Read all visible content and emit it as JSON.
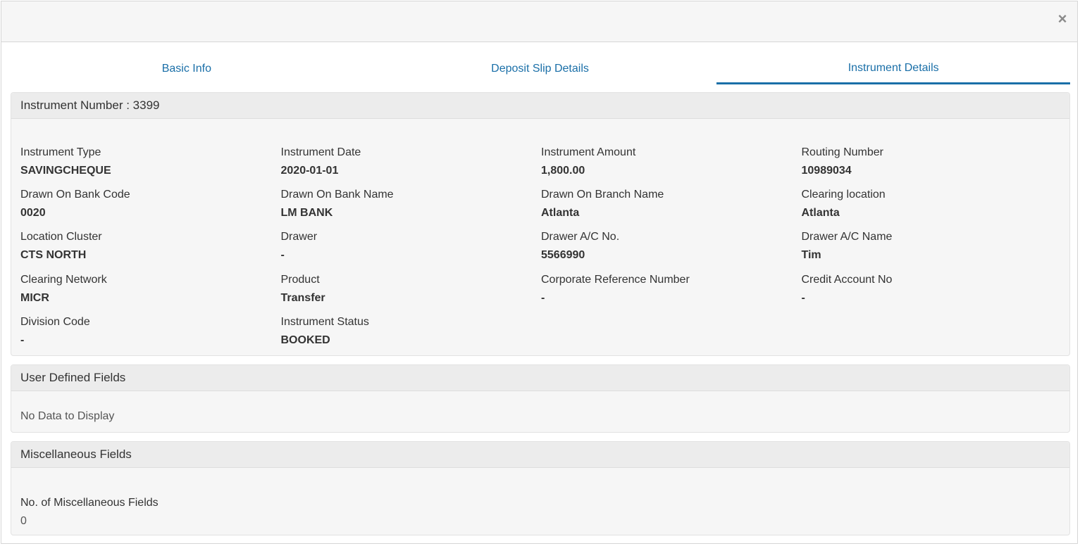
{
  "header": {
    "close_icon": "close-icon",
    "close_glyph": "×"
  },
  "tabs": [
    {
      "label": "Basic Info"
    },
    {
      "label": "Deposit Slip Details"
    },
    {
      "label": "Instrument Details"
    }
  ],
  "instrument": {
    "title": "Instrument Number : 3399",
    "fields": [
      {
        "label": "Instrument Type",
        "value": "SAVINGCHEQUE"
      },
      {
        "label": "Instrument Date",
        "value": "2020-01-01"
      },
      {
        "label": "Instrument Amount",
        "value": "1,800.00"
      },
      {
        "label": "Routing Number",
        "value": "10989034"
      },
      {
        "label": "Drawn On Bank Code",
        "value": "0020"
      },
      {
        "label": "Drawn On Bank Name",
        "value": "LM BANK"
      },
      {
        "label": "Drawn On Branch Name",
        "value": "Atlanta"
      },
      {
        "label": "Clearing location",
        "value": "Atlanta"
      },
      {
        "label": "Location Cluster",
        "value": "CTS NORTH"
      },
      {
        "label": "Drawer",
        "value": "-"
      },
      {
        "label": "Drawer A/C No.",
        "value": "5566990"
      },
      {
        "label": "Drawer A/C Name",
        "value": "Tim"
      },
      {
        "label": "Clearing Network",
        "value": "MICR"
      },
      {
        "label": "Product",
        "value": "Transfer"
      },
      {
        "label": "Corporate Reference Number",
        "value": "-"
      },
      {
        "label": "Credit Account No",
        "value": "-"
      },
      {
        "label": "Division Code",
        "value": "-"
      },
      {
        "label": "Instrument Status",
        "value": "BOOKED"
      }
    ]
  },
  "user_defined": {
    "title": "User Defined Fields",
    "empty_text": "No Data to Display"
  },
  "misc": {
    "title": "Miscellaneous Fields",
    "count_label": "No. of Miscellaneous Fields",
    "count_value": "0"
  },
  "colors": {
    "accent": "#1a6fa8",
    "panel_bg": "#f6f6f6",
    "panel_head_bg": "#ececec"
  }
}
